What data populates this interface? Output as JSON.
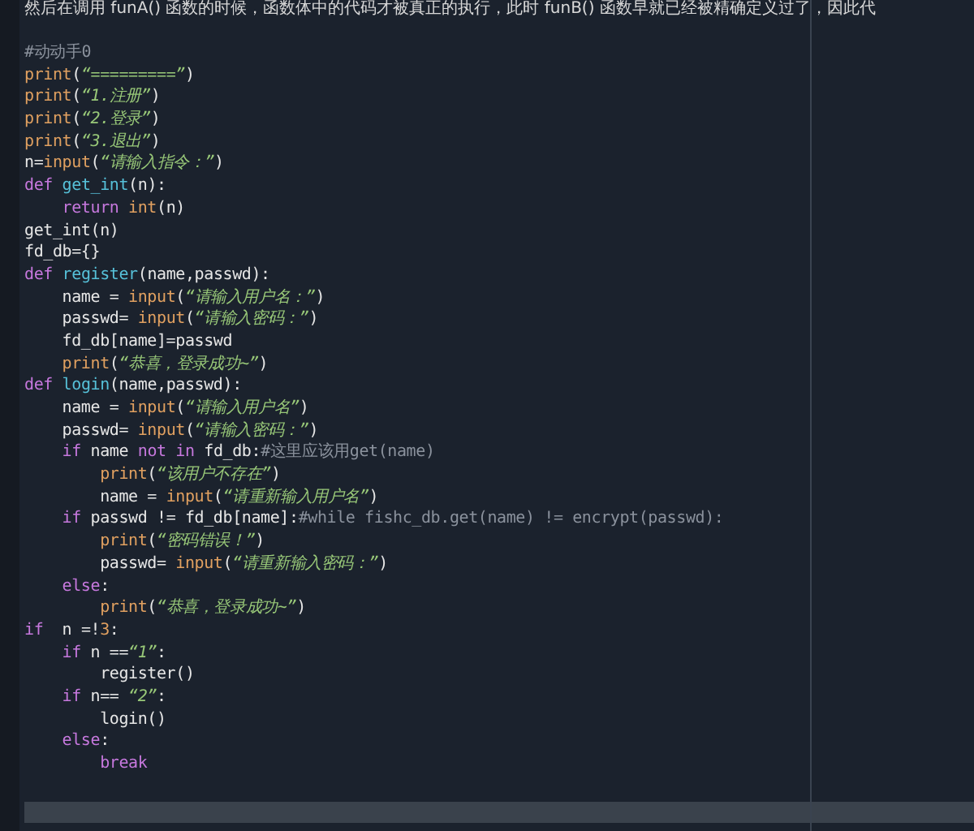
{
  "header_text": "然后在调用 funA() 函数的时候，函数体中的代码才被真正的执行，此时 funB() 函数早就已经被精确定义过了，因此代",
  "code_lines": [
    [
      {
        "kind": "comment",
        "text": "#动动手0"
      }
    ],
    [
      {
        "kind": "builtin",
        "text": "print"
      },
      {
        "kind": "plain",
        "text": "("
      },
      {
        "kind": "string",
        "text": "“=========”"
      },
      {
        "kind": "plain",
        "text": ")"
      }
    ],
    [
      {
        "kind": "builtin",
        "text": "print"
      },
      {
        "kind": "plain",
        "text": "("
      },
      {
        "kind": "string",
        "text": "“1.注册”"
      },
      {
        "kind": "plain",
        "text": ")"
      }
    ],
    [
      {
        "kind": "builtin",
        "text": "print"
      },
      {
        "kind": "plain",
        "text": "("
      },
      {
        "kind": "string",
        "text": "“2.登录”"
      },
      {
        "kind": "plain",
        "text": ")"
      }
    ],
    [
      {
        "kind": "builtin",
        "text": "print"
      },
      {
        "kind": "plain",
        "text": "("
      },
      {
        "kind": "string",
        "text": "“3.退出”"
      },
      {
        "kind": "plain",
        "text": ")"
      }
    ],
    [
      {
        "kind": "plain",
        "text": "n="
      },
      {
        "kind": "builtin",
        "text": "input"
      },
      {
        "kind": "plain",
        "text": "("
      },
      {
        "kind": "string",
        "text": "“请输入指令：”"
      },
      {
        "kind": "plain",
        "text": ")"
      }
    ],
    [
      {
        "kind": "keyword",
        "text": "def "
      },
      {
        "kind": "function",
        "text": "get_int"
      },
      {
        "kind": "plain",
        "text": "(n):"
      }
    ],
    [
      {
        "kind": "keyword",
        "text": "    return "
      },
      {
        "kind": "builtin",
        "text": "int"
      },
      {
        "kind": "plain",
        "text": "(n)"
      }
    ],
    [
      {
        "kind": "plain",
        "text": "get_int(n)"
      }
    ],
    [
      {
        "kind": "plain",
        "text": "fd_db={}"
      }
    ],
    [
      {
        "kind": "keyword",
        "text": "def "
      },
      {
        "kind": "function",
        "text": "register"
      },
      {
        "kind": "plain",
        "text": "(name,passwd):"
      }
    ],
    [
      {
        "kind": "plain",
        "text": "    name = "
      },
      {
        "kind": "builtin",
        "text": "input"
      },
      {
        "kind": "plain",
        "text": "("
      },
      {
        "kind": "string",
        "text": "“请输入用户名：”"
      },
      {
        "kind": "plain",
        "text": ")"
      }
    ],
    [
      {
        "kind": "plain",
        "text": "    passwd= "
      },
      {
        "kind": "builtin",
        "text": "input"
      },
      {
        "kind": "plain",
        "text": "("
      },
      {
        "kind": "string",
        "text": "“请输入密码：”"
      },
      {
        "kind": "plain",
        "text": ")"
      }
    ],
    [
      {
        "kind": "plain",
        "text": "    fd_db[name]=passwd"
      }
    ],
    [
      {
        "kind": "builtin",
        "text": "    print"
      },
      {
        "kind": "plain",
        "text": "("
      },
      {
        "kind": "string",
        "text": "“恭喜，登录成功~”"
      },
      {
        "kind": "plain",
        "text": ")"
      }
    ],
    [
      {
        "kind": "keyword",
        "text": "def "
      },
      {
        "kind": "function",
        "text": "login"
      },
      {
        "kind": "plain",
        "text": "(name,passwd):"
      }
    ],
    [
      {
        "kind": "plain",
        "text": "    name = "
      },
      {
        "kind": "builtin",
        "text": "input"
      },
      {
        "kind": "plain",
        "text": "("
      },
      {
        "kind": "string",
        "text": "“请输入用户名”"
      },
      {
        "kind": "plain",
        "text": ")"
      }
    ],
    [
      {
        "kind": "plain",
        "text": "    passwd= "
      },
      {
        "kind": "builtin",
        "text": "input"
      },
      {
        "kind": "plain",
        "text": "("
      },
      {
        "kind": "string",
        "text": "“请输入密码：”"
      },
      {
        "kind": "plain",
        "text": ")"
      }
    ],
    [
      {
        "kind": "keyword",
        "text": "    if"
      },
      {
        "kind": "plain",
        "text": " name "
      },
      {
        "kind": "keyword",
        "text": "not in"
      },
      {
        "kind": "plain",
        "text": " fd_db:"
      },
      {
        "kind": "comment",
        "text": "#这里应该用get(name)"
      }
    ],
    [
      {
        "kind": "builtin",
        "text": "        print"
      },
      {
        "kind": "plain",
        "text": "("
      },
      {
        "kind": "string",
        "text": "“该用户不存在”"
      },
      {
        "kind": "plain",
        "text": ")"
      }
    ],
    [
      {
        "kind": "plain",
        "text": "        name = "
      },
      {
        "kind": "builtin",
        "text": "input"
      },
      {
        "kind": "plain",
        "text": "("
      },
      {
        "kind": "string",
        "text": "“请重新输入用户名”"
      },
      {
        "kind": "plain",
        "text": ")"
      }
    ],
    [
      {
        "kind": "keyword",
        "text": "    if"
      },
      {
        "kind": "plain",
        "text": " passwd != fd_db[name]:"
      },
      {
        "kind": "comment",
        "text": "#while fishc_db.get(name) != encrypt(passwd):"
      }
    ],
    [
      {
        "kind": "builtin",
        "text": "        print"
      },
      {
        "kind": "plain",
        "text": "("
      },
      {
        "kind": "string",
        "text": "“密码错误！”"
      },
      {
        "kind": "plain",
        "text": ")"
      }
    ],
    [
      {
        "kind": "plain",
        "text": "        passwd= "
      },
      {
        "kind": "builtin",
        "text": "input"
      },
      {
        "kind": "plain",
        "text": "("
      },
      {
        "kind": "string",
        "text": "“请重新输入密码：”"
      },
      {
        "kind": "plain",
        "text": ")"
      }
    ],
    [
      {
        "kind": "keyword",
        "text": "    else"
      },
      {
        "kind": "plain",
        "text": ":"
      }
    ],
    [
      {
        "kind": "builtin",
        "text": "        print"
      },
      {
        "kind": "plain",
        "text": "("
      },
      {
        "kind": "string",
        "text": "“恭喜，登录成功~”"
      },
      {
        "kind": "plain",
        "text": ")"
      }
    ],
    [
      {
        "kind": "keyword",
        "text": "if"
      },
      {
        "kind": "plain",
        "text": "  n =!"
      },
      {
        "kind": "number",
        "text": "3"
      },
      {
        "kind": "plain",
        "text": ":"
      }
    ],
    [
      {
        "kind": "keyword",
        "text": "    if"
      },
      {
        "kind": "plain",
        "text": " n =="
      },
      {
        "kind": "string",
        "text": "“1”"
      },
      {
        "kind": "plain",
        "text": ":"
      }
    ],
    [
      {
        "kind": "plain",
        "text": "        register()"
      }
    ],
    [
      {
        "kind": "keyword",
        "text": "    if"
      },
      {
        "kind": "plain",
        "text": " n== "
      },
      {
        "kind": "string",
        "text": "“2”"
      },
      {
        "kind": "plain",
        "text": ":"
      }
    ],
    [
      {
        "kind": "plain",
        "text": "        login()"
      }
    ],
    [
      {
        "kind": "keyword",
        "text": "    else"
      },
      {
        "kind": "plain",
        "text": ":"
      }
    ],
    [
      {
        "kind": "keyword",
        "text": "        break"
      }
    ]
  ]
}
